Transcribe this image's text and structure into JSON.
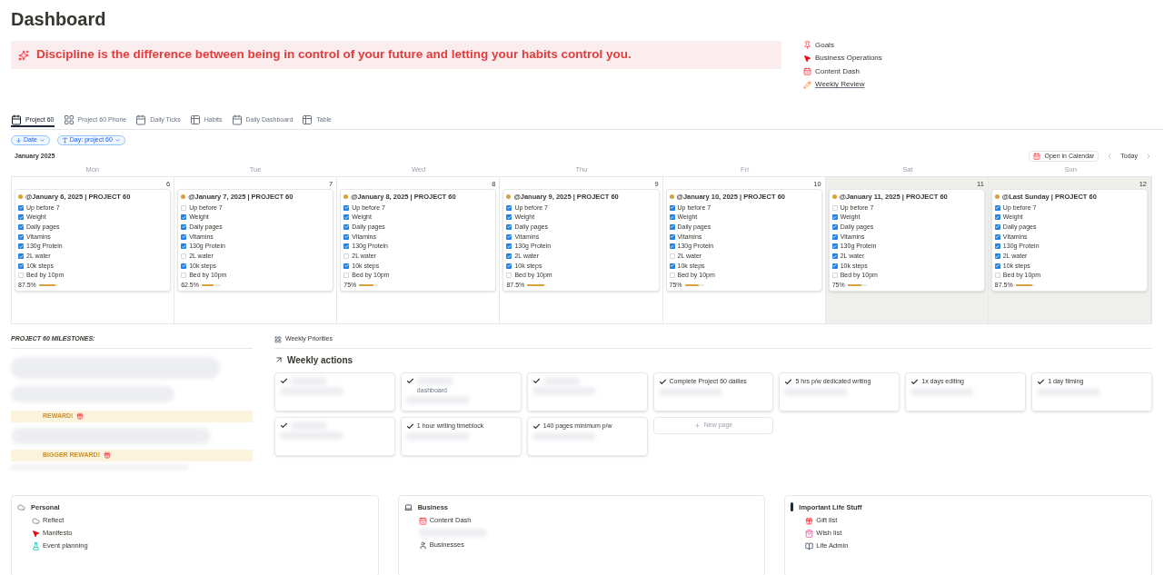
{
  "page_title": "Dashboard",
  "quote": "Discipline is the difference between being in control of your future and letting your habits control you.",
  "quick_links": [
    {
      "label": "Goals",
      "kind": "pin",
      "underlined": false
    },
    {
      "label": "Business Operations",
      "kind": "cursor",
      "underlined": false
    },
    {
      "label": "Content Dash",
      "kind": "calendar",
      "underlined": false
    },
    {
      "label": "Weekly Review",
      "kind": "pencil",
      "underlined": true
    }
  ],
  "view_tabs": [
    {
      "label": "Project 60",
      "kind": "calendar",
      "selected": true
    },
    {
      "label": "Project 60 Phone",
      "kind": "gallery",
      "selected": false
    },
    {
      "label": "Daily Ticks",
      "kind": "calendar",
      "selected": false
    },
    {
      "label": "Habits",
      "kind": "table",
      "selected": false
    },
    {
      "label": "Daily Dashboard",
      "kind": "calendar",
      "selected": false
    },
    {
      "label": "Table",
      "kind": "table",
      "selected": false
    }
  ],
  "filters": [
    {
      "label": "Date",
      "kind": "sort"
    },
    {
      "label": "Day: project 60",
      "kind": "text"
    }
  ],
  "calendar": {
    "month": "January 2025",
    "open_button": "Open in Calendar",
    "today_button": "Today",
    "days": [
      {
        "weekday": "Mon",
        "date": "6",
        "weekend": false,
        "entry": {
          "title": "@January 6, 2025 | PROJECT 60",
          "percent": "87.5%",
          "level": 0.875,
          "habits": [
            {
              "label": "Up before 7",
              "checked": true
            },
            {
              "label": "Weight",
              "checked": true
            },
            {
              "label": "Daily pages",
              "checked": true
            },
            {
              "label": "Vitamins",
              "checked": true
            },
            {
              "label": "130g Protein",
              "checked": true
            },
            {
              "label": "2L water",
              "checked": true
            },
            {
              "label": "10k steps",
              "checked": true
            },
            {
              "label": "Bed by 10pm",
              "checked": false
            }
          ]
        }
      },
      {
        "weekday": "Tue",
        "date": "7",
        "weekend": false,
        "entry": {
          "title": "@January 7, 2025 | PROJECT 60",
          "percent": "62.5%",
          "level": 0.625,
          "habits": [
            {
              "label": "Up before 7",
              "checked": false
            },
            {
              "label": "Weight",
              "checked": true
            },
            {
              "label": "Daily pages",
              "checked": true
            },
            {
              "label": "Vitamins",
              "checked": true
            },
            {
              "label": "130g Protein",
              "checked": true
            },
            {
              "label": "2L water",
              "checked": false
            },
            {
              "label": "10k steps",
              "checked": true
            },
            {
              "label": "Bed by 10pm",
              "checked": false
            }
          ]
        }
      },
      {
        "weekday": "Wed",
        "date": "8",
        "weekend": false,
        "entry": {
          "title": "@January 8, 2025 | PROJECT 60",
          "percent": "75%",
          "level": 0.75,
          "habits": [
            {
              "label": "Up before 7",
              "checked": true
            },
            {
              "label": "Weight",
              "checked": true
            },
            {
              "label": "Daily pages",
              "checked": true
            },
            {
              "label": "Vitamins",
              "checked": true
            },
            {
              "label": "130g Protein",
              "checked": true
            },
            {
              "label": "2L water",
              "checked": false
            },
            {
              "label": "10k steps",
              "checked": true
            },
            {
              "label": "Bed by 10pm",
              "checked": false
            }
          ]
        }
      },
      {
        "weekday": "Thu",
        "date": "9",
        "weekend": false,
        "entry": {
          "title": "@January 9, 2025 | PROJECT 60",
          "percent": "87.5%",
          "level": 0.875,
          "habits": [
            {
              "label": "Up before 7",
              "checked": true
            },
            {
              "label": "Weight",
              "checked": true
            },
            {
              "label": "Daily pages",
              "checked": true
            },
            {
              "label": "Vitamins",
              "checked": true
            },
            {
              "label": "130g Protein",
              "checked": true
            },
            {
              "label": "2L water",
              "checked": true
            },
            {
              "label": "10k steps",
              "checked": true
            },
            {
              "label": "Bed by 10pm",
              "checked": false
            }
          ]
        }
      },
      {
        "weekday": "Fri",
        "date": "10",
        "weekend": false,
        "entry": {
          "title": "@January 10, 2025 | PROJECT 60",
          "percent": "75%",
          "level": 0.75,
          "habits": [
            {
              "label": "Up before 7",
              "checked": true
            },
            {
              "label": "Weight",
              "checked": true
            },
            {
              "label": "Daily pages",
              "checked": true
            },
            {
              "label": "Vitamins",
              "checked": true
            },
            {
              "label": "130g Protein",
              "checked": true
            },
            {
              "label": "2L water",
              "checked": false
            },
            {
              "label": "10k steps",
              "checked": true
            },
            {
              "label": "Bed by 10pm",
              "checked": false
            }
          ]
        }
      },
      {
        "weekday": "Sat",
        "date": "11",
        "weekend": true,
        "entry": {
          "title": "@January 11, 2025 | PROJECT 60",
          "percent": "75%",
          "level": 0.75,
          "habits": [
            {
              "label": "Up before 7",
              "checked": false
            },
            {
              "label": "Weight",
              "checked": true
            },
            {
              "label": "Daily pages",
              "checked": true
            },
            {
              "label": "Vitamins",
              "checked": true
            },
            {
              "label": "130g Protein",
              "checked": true
            },
            {
              "label": "2L water",
              "checked": true
            },
            {
              "label": "10k steps",
              "checked": true
            },
            {
              "label": "Bed by 10pm",
              "checked": false
            }
          ]
        }
      },
      {
        "weekday": "Sun",
        "date": "12",
        "weekend": true,
        "entry": {
          "title": "@Last Sunday | PROJECT 60",
          "percent": "87.5%",
          "level": 0.875,
          "habits": [
            {
              "label": "Up before 7",
              "checked": true
            },
            {
              "label": "Weight",
              "checked": true
            },
            {
              "label": "Daily pages",
              "checked": true
            },
            {
              "label": "Vitamins",
              "checked": true
            },
            {
              "label": "130g Protein",
              "checked": true
            },
            {
              "label": "2L water",
              "checked": true
            },
            {
              "label": "10k steps",
              "checked": true
            },
            {
              "label": "Bed by 10pm",
              "checked": false
            }
          ]
        }
      }
    ]
  },
  "milestones": {
    "heading": "PROJECT 60 MILESTONES:",
    "rewards": [
      "REWARD!",
      "BIGGER REWARD!"
    ]
  },
  "weekly_priorities": {
    "tab": "Weekly Priorities",
    "heading": "Weekly actions",
    "cards": [
      {
        "kind": "action"
      },
      {
        "kind": "action",
        "subtitle": "dashboard"
      },
      {
        "kind": "action"
      },
      {
        "kind": "action",
        "title": "Complete Project 60 dailies"
      },
      {
        "kind": "action",
        "title": "5 hrs p/w dedicated writing"
      },
      {
        "kind": "action",
        "title": "1x days editing"
      },
      {
        "kind": "action",
        "title": "1 day filming"
      },
      {
        "kind": "action"
      },
      {
        "kind": "action",
        "title": "1 hour writing timeblock"
      },
      {
        "kind": "action",
        "title": "140 pages minimum p/w"
      },
      {
        "kind": "new",
        "title": "New page"
      }
    ]
  },
  "sections": [
    {
      "title": "Personal",
      "kind": "cloud",
      "links": [
        {
          "label": "Reflect",
          "kind": "cloud"
        },
        {
          "label": "Manifesto",
          "kind": "cursor"
        },
        {
          "label": "Event planning",
          "kind": "flask"
        }
      ]
    },
    {
      "title": "Business",
      "kind": "laptop",
      "links": [
        {
          "label": "Content Dash",
          "kind": "calendar"
        },
        {
          "kind": "hidden"
        },
        {
          "label": "Businesses",
          "kind": "person"
        }
      ]
    },
    {
      "title": "Important Life Stuff",
      "kind": "exclaim",
      "links": [
        {
          "label": "Gift list",
          "kind": "gift"
        },
        {
          "label": "Wish list",
          "kind": "bag"
        },
        {
          "label": "Life Admin",
          "kind": "book"
        }
      ]
    }
  ]
}
